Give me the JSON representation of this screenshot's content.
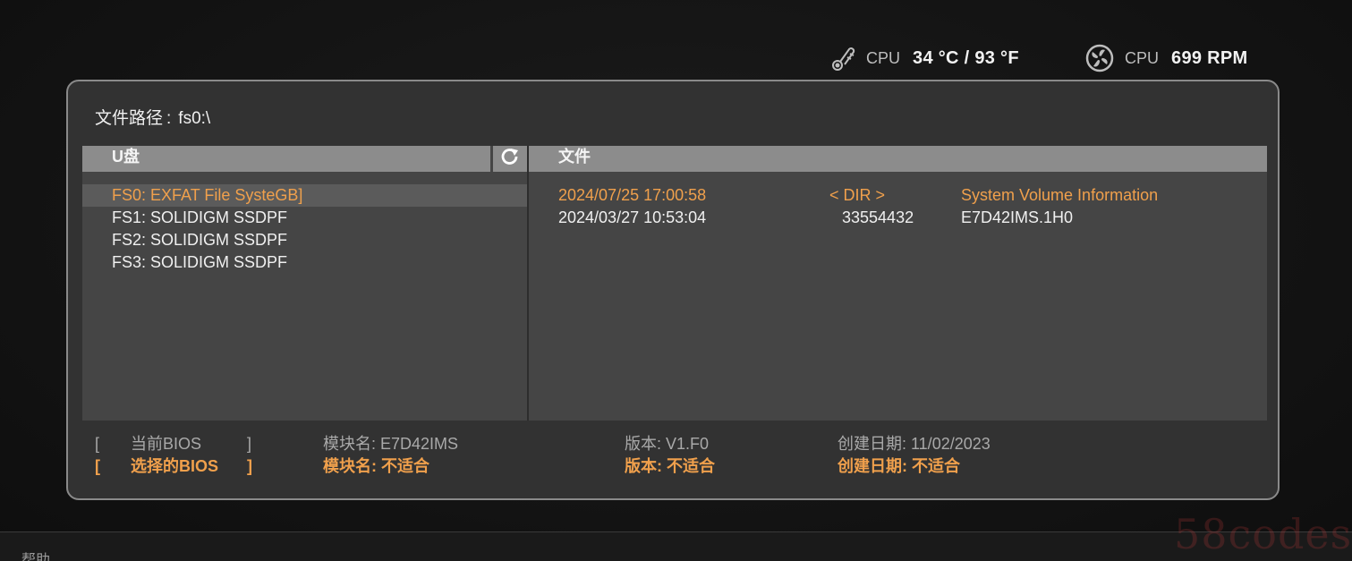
{
  "status": {
    "temp_label": "CPU",
    "temp_value": "34 °C / 93 °F",
    "temp_icon": "thermometer-icon",
    "fan_label": "CPU",
    "fan_value": "699 RPM",
    "fan_icon": "fan-icon"
  },
  "path": {
    "label": "文件路径",
    "separator": ":",
    "value": "fs0:\\"
  },
  "drives": {
    "header": "U盘",
    "refresh_icon": "refresh-icon",
    "items": [
      "FS0: EXFAT File SysteGB]",
      "FS1: SOLIDIGM SSDPF",
      "FS2: SOLIDIGM SSDPF",
      "FS3: SOLIDIGM SSDPF"
    ],
    "selected_index": 0
  },
  "files": {
    "header": "文件",
    "rows": [
      {
        "date": "2024/07/25 17:00:58",
        "size": "< DIR >",
        "name": "System Volume Information"
      },
      {
        "date": "2024/03/27 10:53:04",
        "size": "33554432",
        "name": "E7D42IMS.1H0"
      }
    ]
  },
  "bios": {
    "current": {
      "bracket_open": "[",
      "label": "当前BIOS",
      "bracket_close": "]",
      "module": "模块名: E7D42IMS",
      "version": "版本: V1.F0",
      "date": "创建日期: 11/02/2023"
    },
    "selected": {
      "bracket_open": "[",
      "label": "选择的BIOS",
      "bracket_close": "]",
      "module": "模块名: 不适合",
      "version": "版本: 不适合",
      "date": "创建日期: 不适合"
    }
  },
  "footer": {
    "help": "帮助"
  },
  "watermark": "58codes",
  "colors": {
    "accent": "#f0a04c",
    "panel_bg": "#323232",
    "list_bg": "#454545",
    "header_bg": "#8c8c8c"
  }
}
